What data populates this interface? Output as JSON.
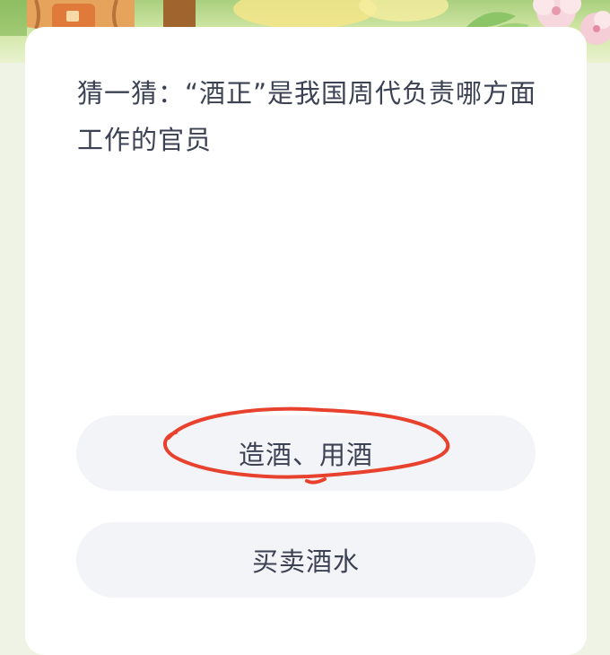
{
  "quiz": {
    "question": "猜一猜：“酒正”是我国周代负责哪方面工作的官员",
    "options": [
      {
        "label": "造酒、用酒"
      },
      {
        "label": "买卖酒水"
      }
    ]
  },
  "colors": {
    "background": "#eef3e6",
    "card": "#ffffff",
    "text": "#3c4254",
    "option_bg": "#f3f4f7",
    "annotation": "#e8422f"
  },
  "annotation": {
    "type": "hand-drawn-circle",
    "target": "option-1"
  }
}
